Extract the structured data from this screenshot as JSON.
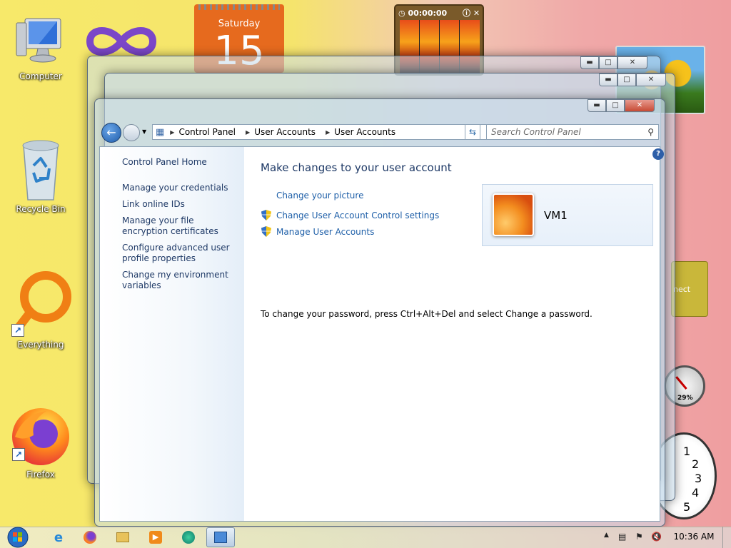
{
  "desktop": {
    "icons": [
      {
        "label": "Computer"
      },
      {
        "label": "Recycle Bin"
      },
      {
        "label": "Everything"
      },
      {
        "label": "Firefox"
      }
    ]
  },
  "gadgets": {
    "calendar_day": "Saturday",
    "calendar_date": "15",
    "timer": "00:00:00",
    "connect_label": "nect",
    "meter_percent": "29%",
    "clock_numbers": [
      "1",
      "2",
      "3",
      "4",
      "5"
    ]
  },
  "window": {
    "breadcrumb": [
      "Control Panel",
      "User Accounts",
      "User Accounts"
    ],
    "search_placeholder": "Search Control Panel",
    "help_label": "?",
    "left_nav": [
      "Control Panel Home",
      "Manage your credentials",
      "Link online IDs",
      "Manage your file encryption certificates",
      "Configure advanced user profile properties",
      "Change my environment variables"
    ],
    "heading": "Make changes to your user account",
    "tasks": [
      {
        "label": "Change your picture",
        "shield": false
      },
      {
        "label": "Change User Account Control settings",
        "shield": true
      },
      {
        "label": "Manage User Accounts",
        "shield": true
      }
    ],
    "note": "To change your password, press Ctrl+Alt+Del and select Change a password.",
    "user_name": "VM1"
  },
  "taskbar": {
    "clock": "10:36 AM",
    "pinned": [
      "internet-explorer",
      "firefox",
      "file-explorer",
      "media-player",
      "network",
      "control-panel"
    ]
  },
  "colors": {
    "link": "#1e5fa8",
    "heading": "#1e3966",
    "desktop_left": "#f5e46c",
    "desktop_right": "#ef9ea0"
  }
}
